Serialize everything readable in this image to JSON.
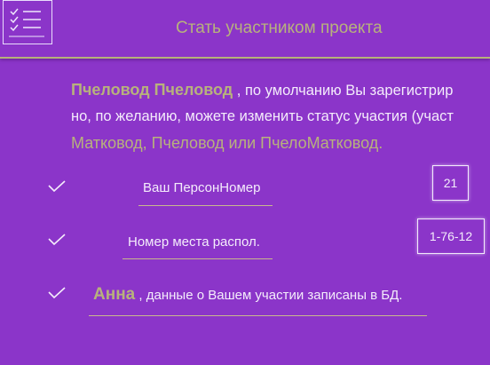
{
  "header": {
    "title": "Стать участником проекта",
    "menu_icon": "checklist-icon"
  },
  "intro": {
    "name": "Пчеловод Пчеловод",
    "line1_rest": " , по умолчанию Вы зарегистрир",
    "line2": "но, по желанию, можете изменить статус участия (участ",
    "line3": "Матковод, Пчеловод или ПчелоМатковод."
  },
  "fields": {
    "person_number": {
      "label": "Ваш ПерсонНомер",
      "value": "21"
    },
    "place_number": {
      "label": "Номер места распол.",
      "value": "1-76-12"
    },
    "status": {
      "name": "Анна",
      "text": " , данные о Вашем участии записаны в БД."
    }
  },
  "icons": {
    "check": "check-icon"
  },
  "colors": {
    "background": "#8b35c9",
    "accent": "#b8b27c",
    "text": "#f4ecfb"
  }
}
